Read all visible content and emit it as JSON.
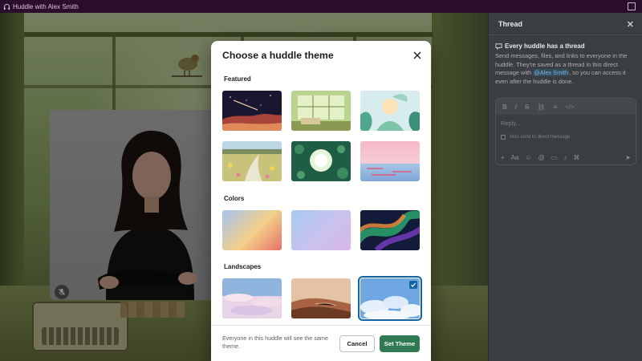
{
  "window": {
    "title": "Huddle with Alex Smith",
    "headphones_icon": "headphones-icon",
    "minimize_icon": "minimize-window-icon"
  },
  "thread": {
    "header": "Thread",
    "close_icon": "close-icon",
    "info_title": "Every huddle has a thread",
    "info_text_1": "Send messages, files, and links to everyone in the huddle. They're saved as a thread in this direct message with",
    "mention": "@Alex Smith",
    "info_text_2": ", so you can access it even after the huddle is done.",
    "composer": {
      "reply_placeholder": "Reply...",
      "also_send_label": "Also send to direct message",
      "format_icons": [
        "bold-icon",
        "italic-icon",
        "strikethrough-icon",
        "link-icon",
        "list-icon",
        "code-icon"
      ],
      "tool_icons": [
        "plus-icon",
        "text-format-icon",
        "emoji-icon",
        "mention-icon",
        "video-icon",
        "microphone-icon",
        "shortcut-icon"
      ],
      "send_icon": "send-icon"
    }
  },
  "huddle": {
    "participant": "Alex Smith",
    "mic_muted_icon": "microphone-muted-icon"
  },
  "modal": {
    "title": "Choose a huddle theme",
    "close_icon": "close-icon",
    "sections": [
      {
        "label": "Featured",
        "themes": [
          "space-scene",
          "greenhouse-window",
          "tropical-leaves",
          "flower-field",
          "lily-pond",
          "pink-sunset-sea"
        ]
      },
      {
        "label": "Colors",
        "themes": [
          "sunset-gradient",
          "lavender-gradient",
          "aurora-gradient"
        ]
      },
      {
        "label": "Landscapes",
        "themes": [
          "pastel-clouds",
          "desert-dunes",
          "blue-sky-clouds"
        ]
      }
    ],
    "selected_theme": "blue-sky-clouds",
    "footer_note": "Everyone in this huddle will see the same theme.",
    "cancel_label": "Cancel",
    "set_label": "Set Theme",
    "accent_color": "#2f7a53",
    "selection_color": "#1264a3"
  }
}
